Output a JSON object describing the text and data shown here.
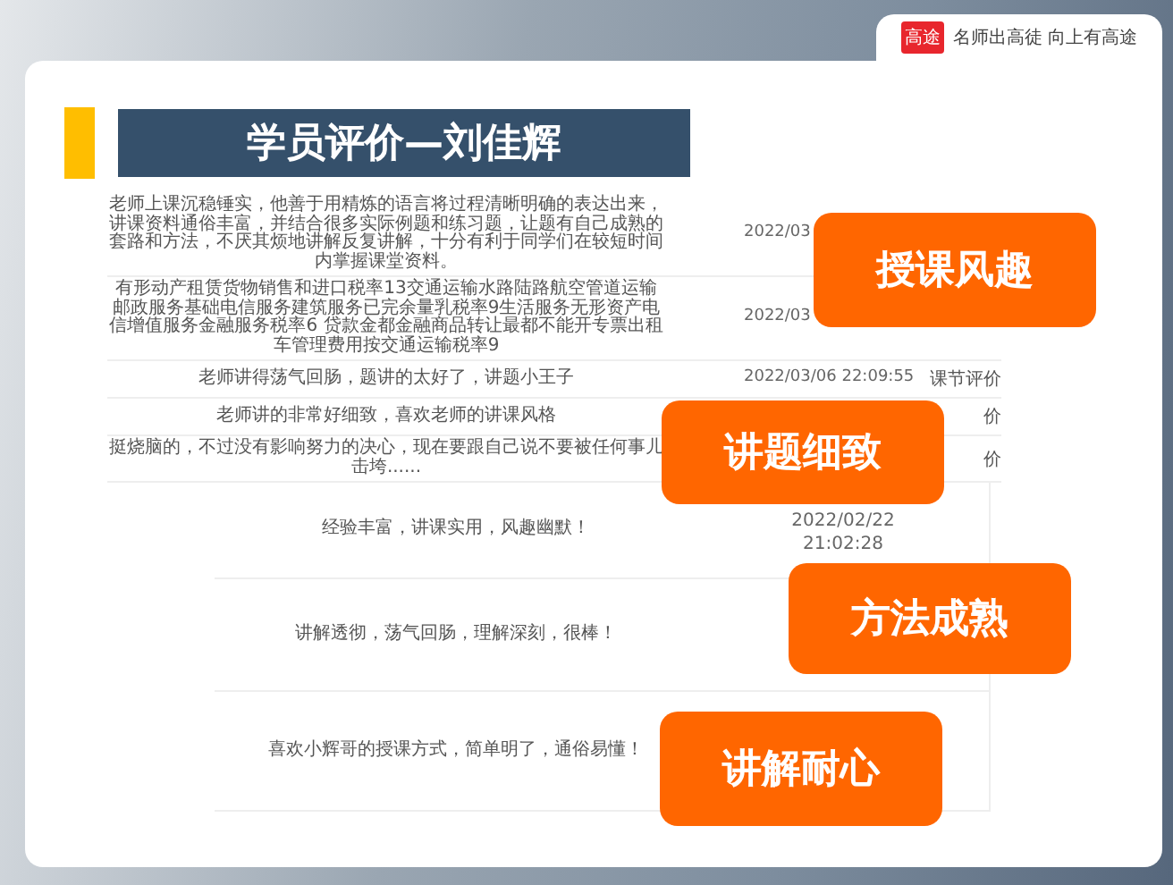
{
  "brand": {
    "logo": "高途",
    "slogan": "名师出高徒 向上有高途"
  },
  "title": "学员评价—刘佳辉",
  "reviews": [
    {
      "kind": "small",
      "text": "老师上课沉稳锤实，他善于用精炼的语言将过程清晰明确的表达出来，讲课资料通俗丰富，并结合很多实际例题和练习题，让题有自己成熟的套路和方法，不厌其烦地讲解反复讲解，十分有利于同学们在较短时间内掌握课堂资料。",
      "date": "2022/03"
    },
    {
      "kind": "small",
      "text": "有形动产租赁货物销售和进口税率13交通运输水路陆路航空管道运输邮政服务基础电信服务建筑服务已完余量乳税率9生活服务无形资产电信增值服务金融服务税率6 贷款金都金融商品转让最都不能开专票出租车管理费用按交通运输税率9",
      "date": "2022/03"
    },
    {
      "kind": "small",
      "text": "老师讲得荡气回肠，题讲的太好了，讲题小王子",
      "date": "2022/03/06 22:09:55",
      "column_3": "课节评价"
    },
    {
      "kind": "small",
      "text": "老师讲的非常好细致，喜欢老师的讲课风格",
      "column_3": "价"
    },
    {
      "kind": "small",
      "text": "挺烧脑的，不过没有影响努力的决心，现在要跟自己说不要被任何事儿击垮......",
      "column_3": "价"
    },
    {
      "kind": "large",
      "text": "经验丰富，讲课实用，风趣幽默！",
      "date": "2022/02/22 21:02:28"
    },
    {
      "kind": "large",
      "text": "讲解透彻，荡气回肠，理解深刻，很棒！"
    },
    {
      "kind": "large",
      "text": "喜欢小辉哥的授课方式，简单明了，通俗易懂！"
    }
  ],
  "highlights": [
    "授课风趣",
    "讲题细致",
    "方法成熟",
    "讲解耐心"
  ]
}
